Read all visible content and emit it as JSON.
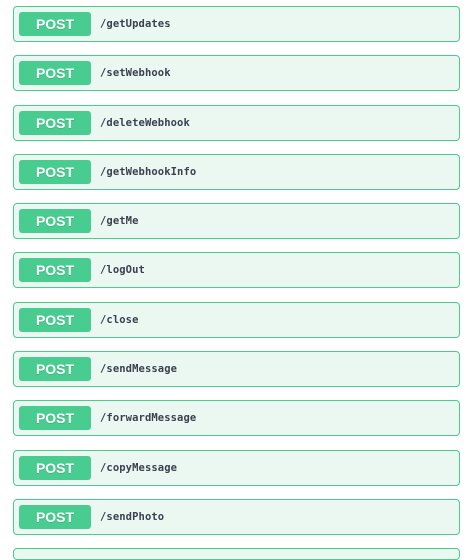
{
  "colors": {
    "post_accent": "#49cc90",
    "post_background": "#ebf7f1",
    "path_text": "#3b4151"
  },
  "operations": [
    {
      "method": "POST",
      "path": "/getUpdates"
    },
    {
      "method": "POST",
      "path": "/setWebhook"
    },
    {
      "method": "POST",
      "path": "/deleteWebhook"
    },
    {
      "method": "POST",
      "path": "/getWebhookInfo"
    },
    {
      "method": "POST",
      "path": "/getMe"
    },
    {
      "method": "POST",
      "path": "/logOut"
    },
    {
      "method": "POST",
      "path": "/close"
    },
    {
      "method": "POST",
      "path": "/sendMessage"
    },
    {
      "method": "POST",
      "path": "/forwardMessage"
    },
    {
      "method": "POST",
      "path": "/copyMessage"
    },
    {
      "method": "POST",
      "path": "/sendPhoto"
    }
  ]
}
